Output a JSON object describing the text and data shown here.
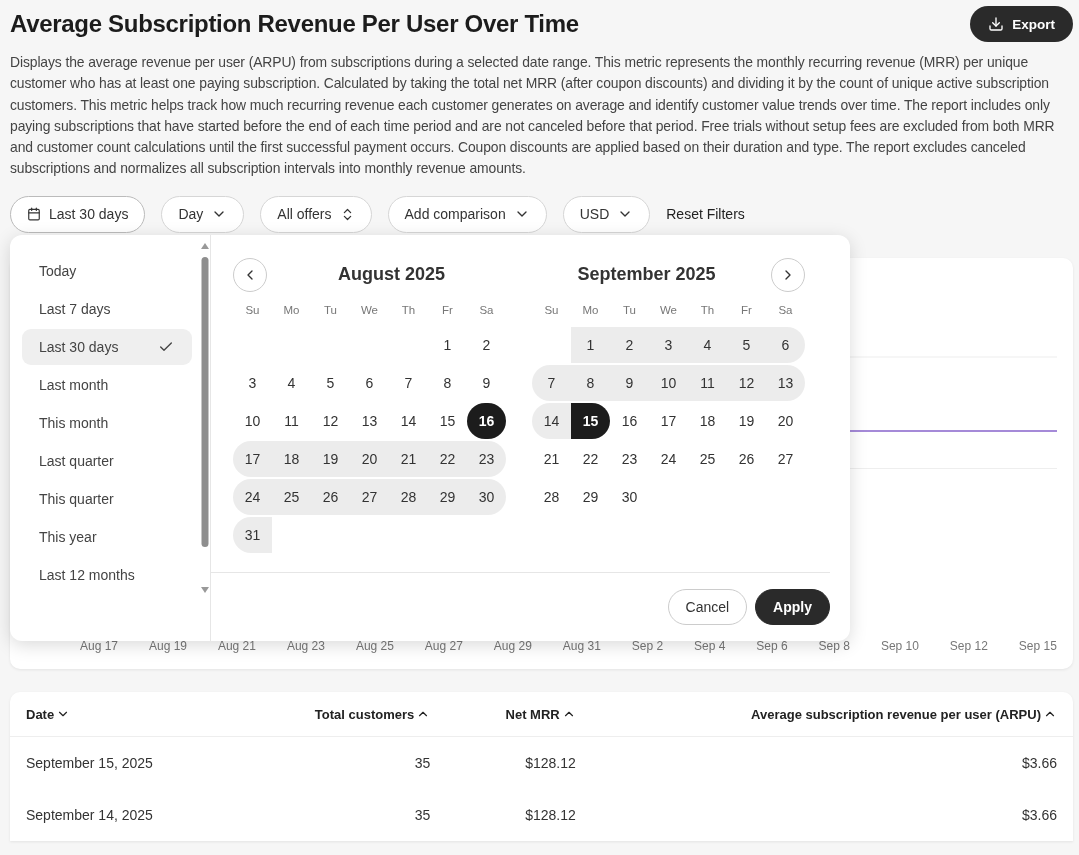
{
  "title": "Average Subscription Revenue Per User Over Time",
  "export_button": {
    "label": "Export"
  },
  "description": "Displays the average revenue per user (ARPU) from subscriptions during a selected date range. This metric represents the monthly recurring revenue (MRR) per unique customer who has at least one paying subscription. Calculated by taking the total net MRR (after coupon discounts) and dividing it by the count of unique active subscription customers. This metric helps track how much recurring revenue each customer generates on average and identify customer value trends over time. The report includes only paying subscriptions that have started before the end of each time period and are not canceled before that period. Free trials without setup fees are excluded from both MRR and customer count calculations until the first successful payment occurs. Coupon discounts are applied based on their duration and type. The report excludes canceled subscriptions and normalizes all subscription intervals into monthly revenue amounts.",
  "filters": [
    {
      "kind": "date",
      "label": "Last 30 days"
    },
    {
      "kind": "dropdown",
      "label": "Day"
    },
    {
      "kind": "select",
      "label": "All offers"
    },
    {
      "kind": "dropdown",
      "label": "Add comparison"
    },
    {
      "kind": "dropdown",
      "label": "USD"
    },
    {
      "kind": "link",
      "label": "Reset Filters"
    }
  ],
  "date_picker": {
    "presets": [
      {
        "label": "Today",
        "selected": false
      },
      {
        "label": "Last 7 days",
        "selected": false
      },
      {
        "label": "Last 30 days",
        "selected": true
      },
      {
        "label": "Last month",
        "selected": false
      },
      {
        "label": "This month",
        "selected": false
      },
      {
        "label": "Last quarter",
        "selected": false
      },
      {
        "label": "This quarter",
        "selected": false
      },
      {
        "label": "This year",
        "selected": false
      },
      {
        "label": "Last 12 months",
        "selected": false
      }
    ],
    "months": [
      {
        "title": "August 2025",
        "weekdays": [
          "Su",
          "Mo",
          "Tu",
          "We",
          "Th",
          "Fr",
          "Sa"
        ],
        "weeks": [
          [
            {
              "day": "1",
              "selected": false,
              "in_range": false
            },
            {
              "day": "2",
              "selected": false,
              "in_range": false
            }
          ],
          [
            {
              "day": "3",
              "selected": false,
              "in_range": false
            },
            {
              "day": "4",
              "selected": false,
              "in_range": false
            },
            {
              "day": "5",
              "selected": false,
              "in_range": false
            },
            {
              "day": "6",
              "selected": false,
              "in_range": false
            },
            {
              "day": "7",
              "selected": false,
              "in_range": false
            },
            {
              "day": "8",
              "selected": false,
              "in_range": false
            },
            {
              "day": "9",
              "selected": false,
              "in_range": false
            }
          ],
          [
            {
              "day": "10",
              "selected": false,
              "in_range": false
            },
            {
              "day": "11",
              "selected": false,
              "in_range": false
            },
            {
              "day": "12",
              "selected": false,
              "in_range": false
            },
            {
              "day": "13",
              "selected": false,
              "in_range": false
            },
            {
              "day": "14",
              "selected": false,
              "in_range": false
            },
            {
              "day": "15",
              "selected": false,
              "in_range": false
            },
            {
              "day": "16",
              "selected": true,
              "in_range": false
            }
          ],
          [
            {
              "day": "17",
              "selected": false,
              "in_range": true
            },
            {
              "day": "18",
              "selected": false,
              "in_range": true
            },
            {
              "day": "19",
              "selected": false,
              "in_range": true
            },
            {
              "day": "20",
              "selected": false,
              "in_range": true
            },
            {
              "day": "21",
              "selected": false,
              "in_range": true
            },
            {
              "day": "22",
              "selected": false,
              "in_range": true
            },
            {
              "day": "23",
              "selected": false,
              "in_range": true
            }
          ],
          [
            {
              "day": "24",
              "selected": false,
              "in_range": true
            },
            {
              "day": "25",
              "selected": false,
              "in_range": true
            },
            {
              "day": "26",
              "selected": false,
              "in_range": true
            },
            {
              "day": "27",
              "selected": false,
              "in_range": true
            },
            {
              "day": "28",
              "selected": false,
              "in_range": true
            },
            {
              "day": "29",
              "selected": false,
              "in_range": true
            },
            {
              "day": "30",
              "selected": false,
              "in_range": true
            }
          ],
          [
            {
              "day": "31",
              "selected": false,
              "in_range": true
            }
          ]
        ]
      },
      {
        "title": "September 2025",
        "weekdays": [
          "Su",
          "Mo",
          "Tu",
          "We",
          "Th",
          "Fr",
          "Sa"
        ],
        "weeks": [
          [
            {
              "day": "1",
              "selected": false,
              "in_range": true
            },
            {
              "day": "2",
              "selected": false,
              "in_range": true
            },
            {
              "day": "3",
              "selected": false,
              "in_range": true
            },
            {
              "day": "4",
              "selected": false,
              "in_range": true
            },
            {
              "day": "5",
              "selected": false,
              "in_range": true
            },
            {
              "day": "6",
              "selected": false,
              "in_range": true
            }
          ],
          [
            {
              "day": "7",
              "selected": false,
              "in_range": true
            },
            {
              "day": "8",
              "selected": false,
              "in_range": true
            },
            {
              "day": "9",
              "selected": false,
              "in_range": true
            },
            {
              "day": "10",
              "selected": false,
              "in_range": true
            },
            {
              "day": "11",
              "selected": false,
              "in_range": true
            },
            {
              "day": "12",
              "selected": false,
              "in_range": true
            },
            {
              "day": "13",
              "selected": false,
              "in_range": true
            }
          ],
          [
            {
              "day": "14",
              "selected": false,
              "in_range": true
            },
            {
              "day": "15",
              "selected": true,
              "in_range": false
            },
            {
              "day": "16",
              "selected": false,
              "in_range": false
            },
            {
              "day": "17",
              "selected": false,
              "in_range": false
            },
            {
              "day": "18",
              "selected": false,
              "in_range": false
            },
            {
              "day": "19",
              "selected": false,
              "in_range": false
            },
            {
              "day": "20",
              "selected": false,
              "in_range": false
            }
          ],
          [
            {
              "day": "21",
              "selected": false,
              "in_range": false
            },
            {
              "day": "22",
              "selected": false,
              "in_range": false
            },
            {
              "day": "23",
              "selected": false,
              "in_range": false
            },
            {
              "day": "24",
              "selected": false,
              "in_range": false
            },
            {
              "day": "25",
              "selected": false,
              "in_range": false
            },
            {
              "day": "26",
              "selected": false,
              "in_range": false
            },
            {
              "day": "27",
              "selected": false,
              "in_range": false
            }
          ],
          [
            {
              "day": "28",
              "selected": false,
              "in_range": false
            },
            {
              "day": "29",
              "selected": false,
              "in_range": false
            },
            {
              "day": "30",
              "selected": false,
              "in_range": false
            }
          ]
        ]
      }
    ],
    "buttons": [
      {
        "kind": "secondary",
        "label": "Cancel"
      },
      {
        "kind": "primary",
        "label": "Apply"
      }
    ]
  },
  "chart": {
    "x_labels": [
      "Aug 17",
      "Aug 19",
      "Aug 21",
      "Aug 23",
      "Aug 25",
      "Aug 27",
      "Aug 29",
      "Aug 31",
      "Sep 2",
      "Sep 4",
      "Sep 6",
      "Sep 8",
      "Sep 10",
      "Sep 12",
      "Sep 15"
    ]
  },
  "table": {
    "columns": [
      {
        "label": "Date",
        "descending": true
      },
      {
        "label": "Total customers",
        "descending": false
      },
      {
        "label": "Net MRR",
        "descending": false
      },
      {
        "label": "Average subscription revenue per user (ARPU)",
        "descending": false
      }
    ],
    "rows": [
      [
        "September 15, 2025",
        "35",
        "$128.12",
        "$3.66"
      ],
      [
        "September 14, 2025",
        "35",
        "$128.12",
        "$3.66"
      ]
    ]
  }
}
